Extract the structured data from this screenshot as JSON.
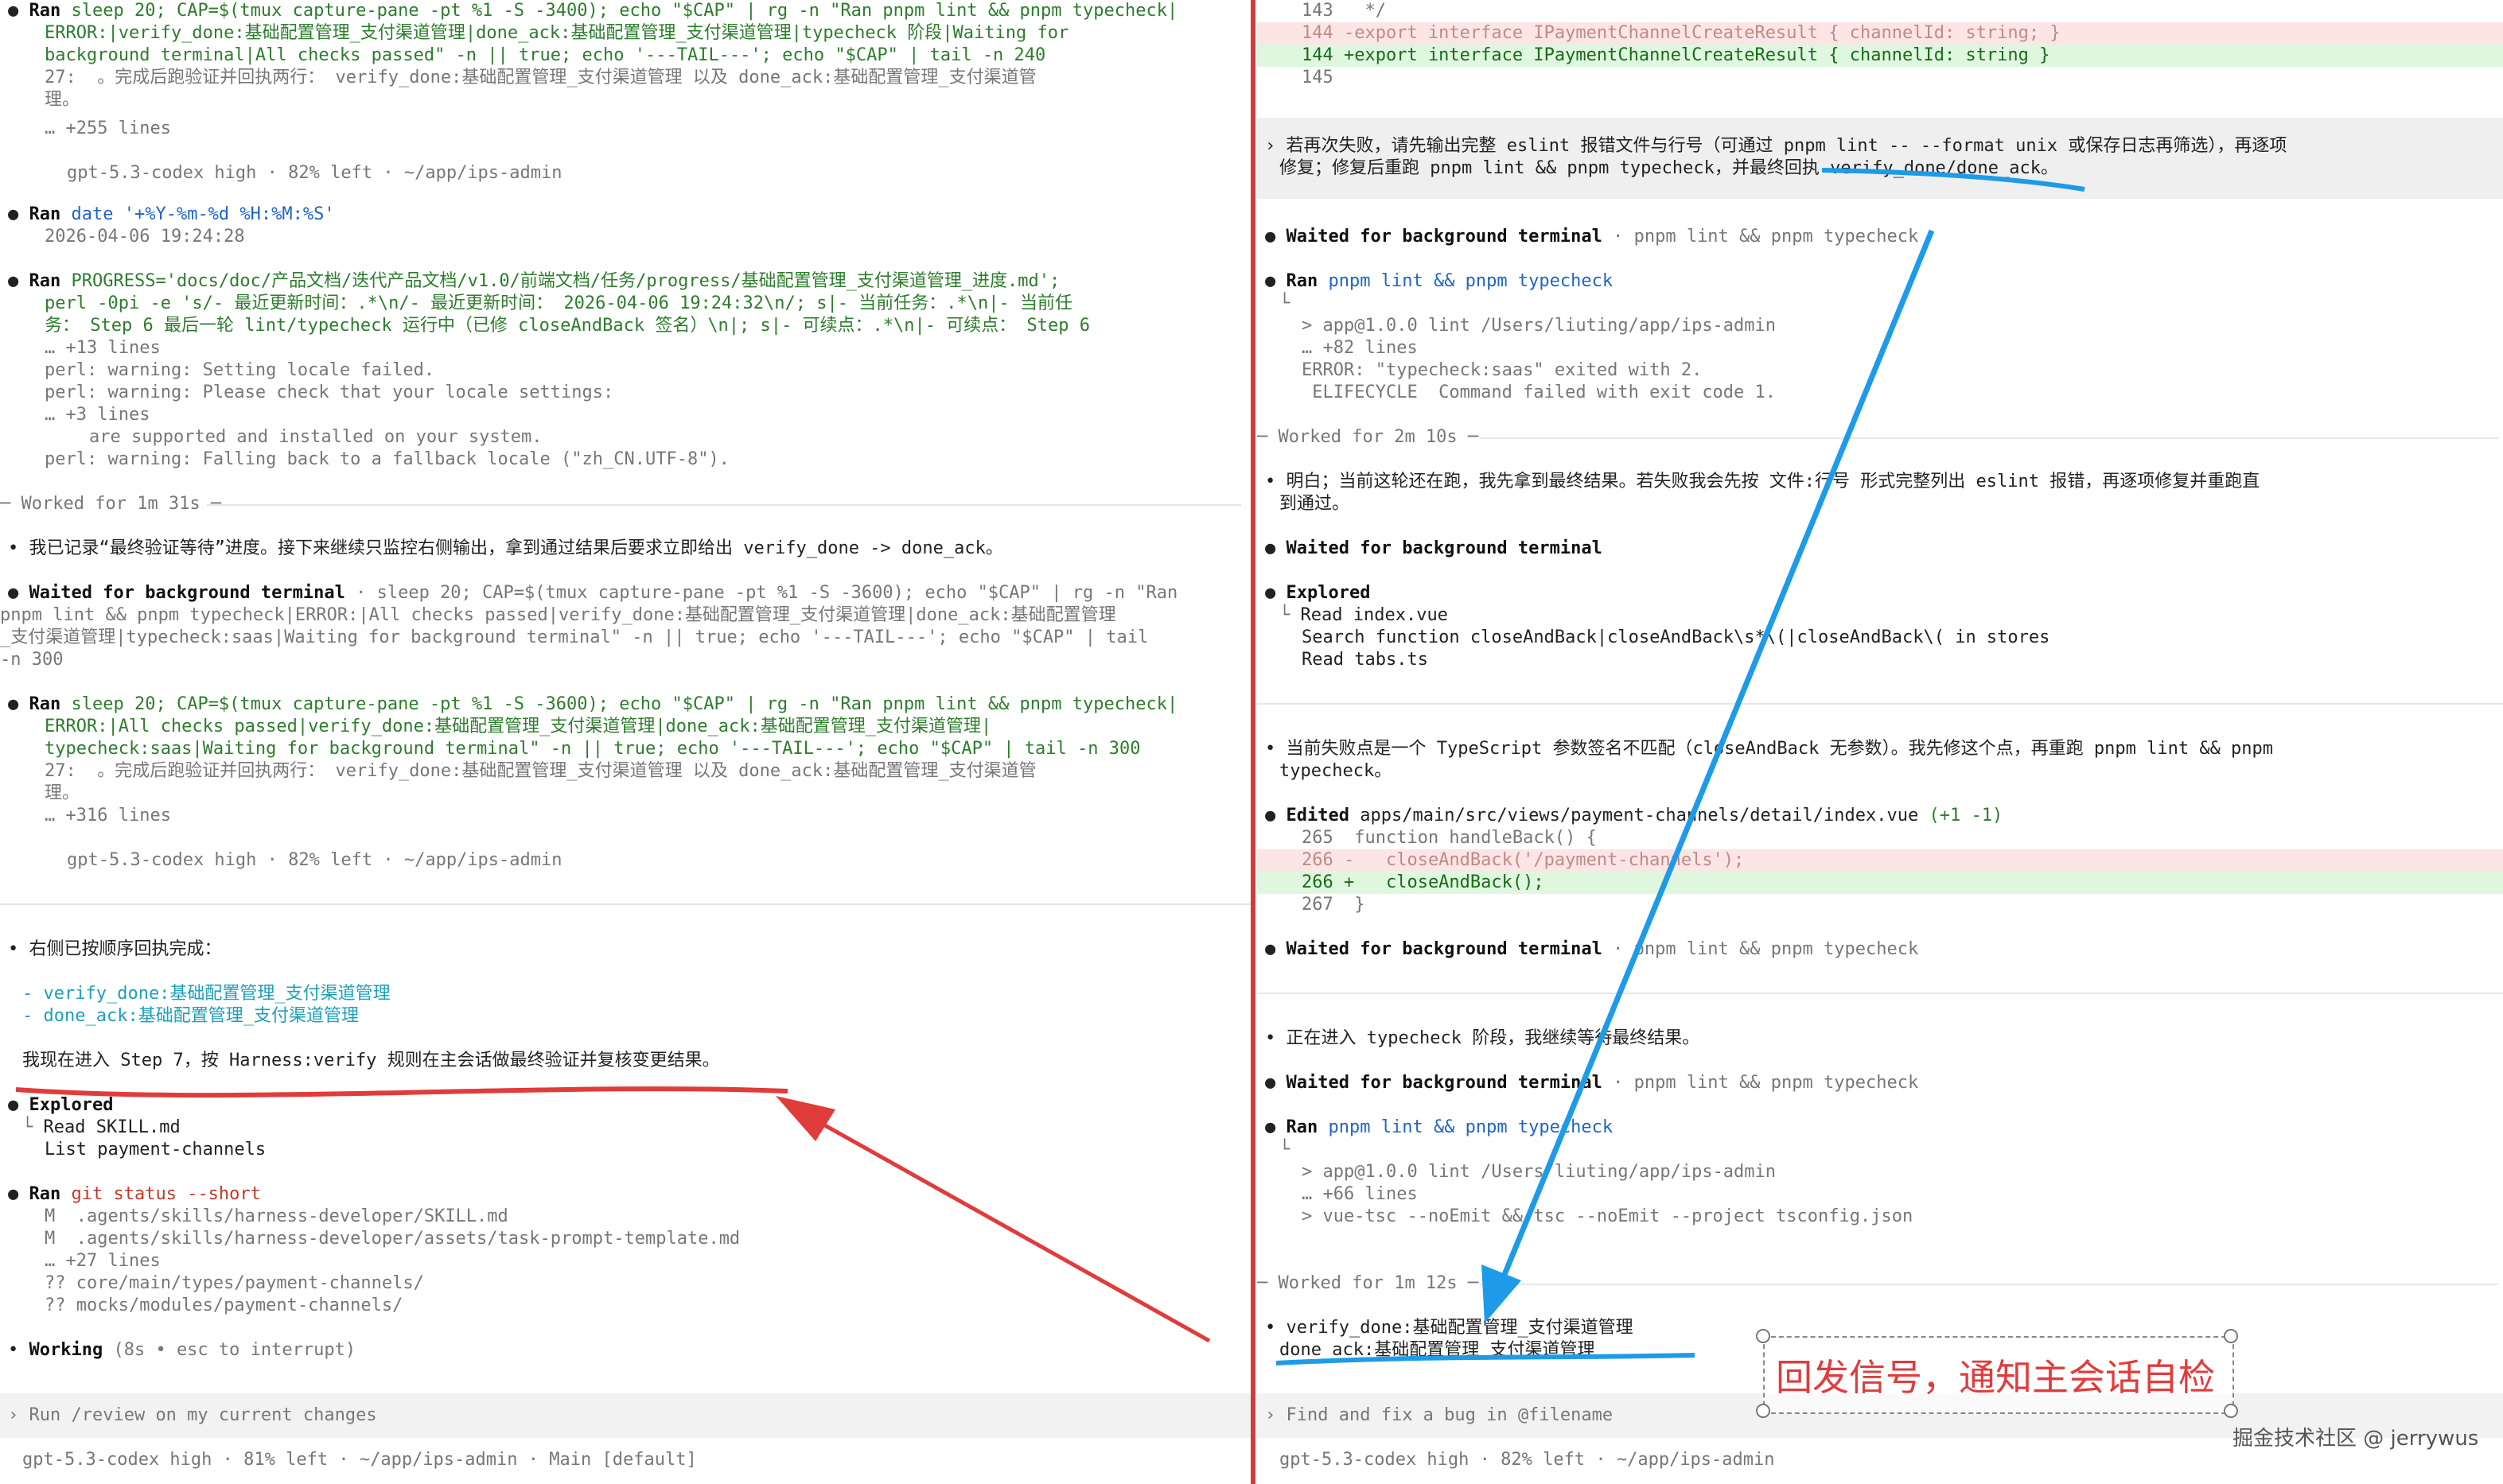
{
  "left": {
    "run1": {
      "label": "Ran",
      "cmd": "sleep 20; CAP=$(tmux capture-pane -pt %1 -S -3400); echo \"$CAP\" | rg -n \"Ran pnpm lint && pnpm typecheck|",
      "cont1": "ERROR:|verify_done:基础配置管理_支付渠道管理|done_ack:基础配置管理_支付渠道管理|typecheck 阶段|Waiting for",
      "cont2": "background terminal|All checks passed\" -n || true; echo '---TAIL---'; echo \"$CAP\" | tail -n 240",
      "out1": "27:  。完成后跑验证并回执两行： verify_done:基础配置管理_支付渠道管理 以及 done_ack:基础配置管理_支付渠道管",
      "out2": "理。",
      "more": "… +255 lines",
      "status": "gpt-5.3-codex high · 82% left · ~/app/ips-admin"
    },
    "run2": {
      "label": "Ran",
      "cmd": "date '+%Y-%m-%d %H:%M:%S'",
      "out": "2026-04-06 19:24:28"
    },
    "run3": {
      "label": "Ran",
      "cmd": "PROGRESS='docs/doc/产品文档/迭代产品文档/v1.0/前端文档/任务/progress/基础配置管理_支付渠道管理_进度.md';",
      "cont1": "perl -0pi -e 's/- 最近更新时间：.*\\n/- 最近更新时间： 2026-04-06 19:24:32\\n/; s|- 当前任务：.*\\n|- 当前任",
      "cont2": "务： Step 6 最后一轮 lint/typecheck 运行中（已修 closeAndBack 签名）\\n|; s|- 可续点：.*\\n|- 可续点： Step 6",
      "more1": "… +13 lines",
      "w1": "perl: warning: Setting locale failed.",
      "w2": "perl: warning: Please check that your locale settings:",
      "more2": "… +3 lines",
      "w3": "are supported and installed on your system.",
      "w4": "perl: warning: Falling back to a fallback locale (\"zh_CN.UTF-8\")."
    },
    "worked1": "Worked for 1m 31s",
    "msg1": "我已记录“最终验证等待”进度。接下来继续只监控右侧输出，拿到通过结果后要求立即给出 verify_done -> done_ack。",
    "wait1": {
      "label": "Waited for background terminal",
      "l1": " · sleep 20; CAP=$(tmux capture-pane -pt %1 -S -3600); echo \"$CAP\" | rg -n \"Ran",
      "l2": "pnpm lint && pnpm typecheck|ERROR:|All checks passed|verify_done:基础配置管理_支付渠道管理|done_ack:基础配置管理",
      "l3": "_支付渠道管理|typecheck:saas|Waiting for background terminal\" -n || true; echo '---TAIL---'; echo \"$CAP\" | tail",
      "l4": "-n 300"
    },
    "run4": {
      "label": "Ran",
      "cmd": "sleep 20; CAP=$(tmux capture-pane -pt %1 -S -3600); echo \"$CAP\" | rg -n \"Ran pnpm lint && pnpm typecheck|",
      "cont1": "ERROR:|All checks passed|verify_done:基础配置管理_支付渠道管理|done_ack:基础配置管理_支付渠道管理|",
      "cont2": "typecheck:saas|Waiting for background terminal\" -n || true; echo '---TAIL---'; echo \"$CAP\" | tail -n 300",
      "out1": "27:  。完成后跑验证并回执两行： verify_done:基础配置管理_支付渠道管理 以及 done_ack:基础配置管理_支付渠道管",
      "out2": "理。",
      "more": "… +316 lines",
      "status": "gpt-5.3-codex high · 82% left · ~/app/ips-admin"
    },
    "msg2": "右侧已按顺序回执完成：",
    "ack1": "- verify_done:基础配置管理_支付渠道管理",
    "ack2": "- done_ack:基础配置管理_支付渠道管理",
    "msg3": "我现在进入 Step 7，按 Harness:verify 规则在主会话做最终验证并复核变更结果。",
    "explored": {
      "label": "Explored",
      "r1": "Read SKILL.md",
      "r2": "List payment-channels"
    },
    "run5": {
      "label": "Ran",
      "cmd": "git status --short",
      "f1": "M  .agents/skills/harness-developer/SKILL.md",
      "f2": "M  .agents/skills/harness-developer/assets/task-prompt-template.md",
      "more": "… +27 lines",
      "f3": "?? core/main/types/payment-channels/",
      "f4": "?? mocks/modules/payment-channels/"
    },
    "working": "Working",
    "working_hint": "(8s • esc to interrupt)",
    "input_placeholder": "Run /review on my current changes",
    "status": "gpt-5.3-codex high · 81% left · ~/app/ips-admin · Main [default]"
  },
  "right": {
    "diff_top": {
      "l143": "143   */",
      "l144_del": "144 -export interface IPaymentChannelCreateResult { channelId: string; }",
      "l144_add": "144 +export interface IPaymentChannelCreateResult { channelId: string }",
      "l145": "145"
    },
    "msg1": "若再次失败，请先输出完整 eslint 报错文件与行号（可通过 pnpm lint -- --format unix 或保存日志再筛选），再逐项",
    "msg1b": "修复；修复后重跑 pnpm lint && pnpm typecheck，并最终回执 verify_done/done_ack。",
    "wait1": {
      "label": "Waited for background terminal",
      "hint": " · pnpm lint && pnpm typecheck"
    },
    "run1": {
      "label": "Ran",
      "cmd": "pnpm lint && pnpm typecheck",
      "o1": "> app@1.0.0 lint /Users/liuting/app/ips-admin",
      "o2": "… +82 lines",
      "o3": "ERROR: \"typecheck:saas\" exited with 2.",
      "o4": " ELIFECYCLE  Command failed with exit code 1."
    },
    "worked1": "Worked for 2m 10s",
    "msg2": "明白；当前这轮还在跑，我先拿到最终结果。若失败我会先按 文件:行号 形式完整列出 eslint 报错，再逐项修复并重跑直",
    "msg2b": "到通过。",
    "wait2": {
      "label": "Waited for background terminal"
    },
    "explored": {
      "label": "Explored",
      "r1": "Read index.vue",
      "r2": "Search function closeAndBack|closeAndBack\\s*\\(|closeAndBack\\( in stores",
      "r3": "Read tabs.ts"
    },
    "msg3": "当前失败点是一个 TypeScript 参数签名不匹配（closeAndBack 无参数）。我先修这个点，再重跑 pnpm lint && pnpm",
    "msg3b": "typecheck。",
    "edited": {
      "label": "Edited",
      "file": "apps/main/src/views/payment-channels/detail/index.vue",
      "stat": "(+1 -1)",
      "l265": "265  function handleBack() {",
      "l266d": "266 -   closeAndBack('/payment-channels');",
      "l266a": "266 +   closeAndBack();",
      "l267": "267  }"
    },
    "wait3": {
      "label": "Waited for background terminal",
      "hint": " · pnpm lint && pnpm typecheck"
    },
    "msg4": "正在进入 typecheck 阶段，我继续等待最终结果。",
    "wait4": {
      "label": "Waited for background terminal",
      "hint": " · pnpm lint && pnpm typecheck"
    },
    "run2": {
      "label": "Ran",
      "cmd": "pnpm lint && pnpm typecheck",
      "o1": "> app@1.0.0 lint /Users/liuting/app/ips-admin",
      "o2": "… +66 lines",
      "o3": "> vue-tsc --noEmit && tsc --noEmit --project tsconfig.json"
    },
    "worked2": "Worked for 1m 12s",
    "ack1": "verify_done:基础配置管理_支付渠道管理",
    "ack2": "done_ack:基础配置管理_支付渠道管理",
    "input_placeholder": "Find and fix a bug in @filename",
    "status": "gpt-5.3-codex high · 82% left · ~/app/ips-admin"
  },
  "annotation": {
    "text": "回发信号，通知主会话自检",
    "color_red": "#e03c3c",
    "color_blue": "#1e9be8"
  },
  "watermark": "掘金技术社区 @ jerrywus"
}
